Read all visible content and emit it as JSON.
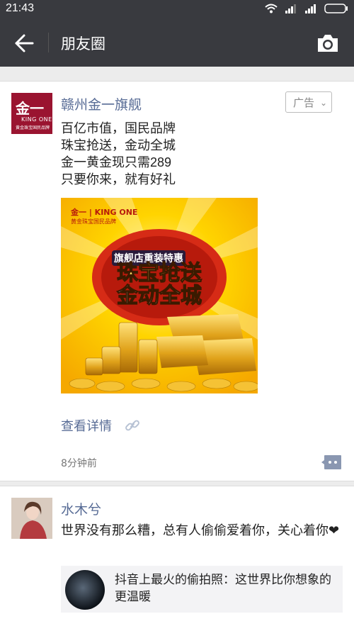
{
  "status_bar": {
    "time": "21:43"
  },
  "app_bar": {
    "title": "朋友圈"
  },
  "posts": [
    {
      "author": "赣州金一旗舰",
      "avatar": {
        "big_text": "金一",
        "en_text": "KING ONE",
        "cn_text": "黄金珠宝国民品牌"
      },
      "ad_label": "广告",
      "text_lines": [
        "百亿市值，国民品牌",
        "珠宝抢送，金动全城",
        "金一黄金现只需289",
        "只要你来，就有好礼"
      ],
      "image": {
        "brand": "金一 | KING ONE",
        "brand_sub": "黄金珠宝国民品牌",
        "banner_small": "旗舰店重装特惠",
        "banner_line1": "珠宝抢送",
        "banner_line2": "金动全城"
      },
      "link_text": "查看详情",
      "time_ago": "8分钟前"
    },
    {
      "author": "水木兮",
      "text": "世界没有那么糟，总有人偷偷爱着你，关心着你❤",
      "share_card": {
        "title": "抖音上最火的偷拍照：这世界比你想象的更温暖"
      }
    }
  ],
  "icons": {
    "back": "back-arrow-icon",
    "camera": "camera-icon",
    "link": "link-icon",
    "comment": "comment-icon"
  }
}
